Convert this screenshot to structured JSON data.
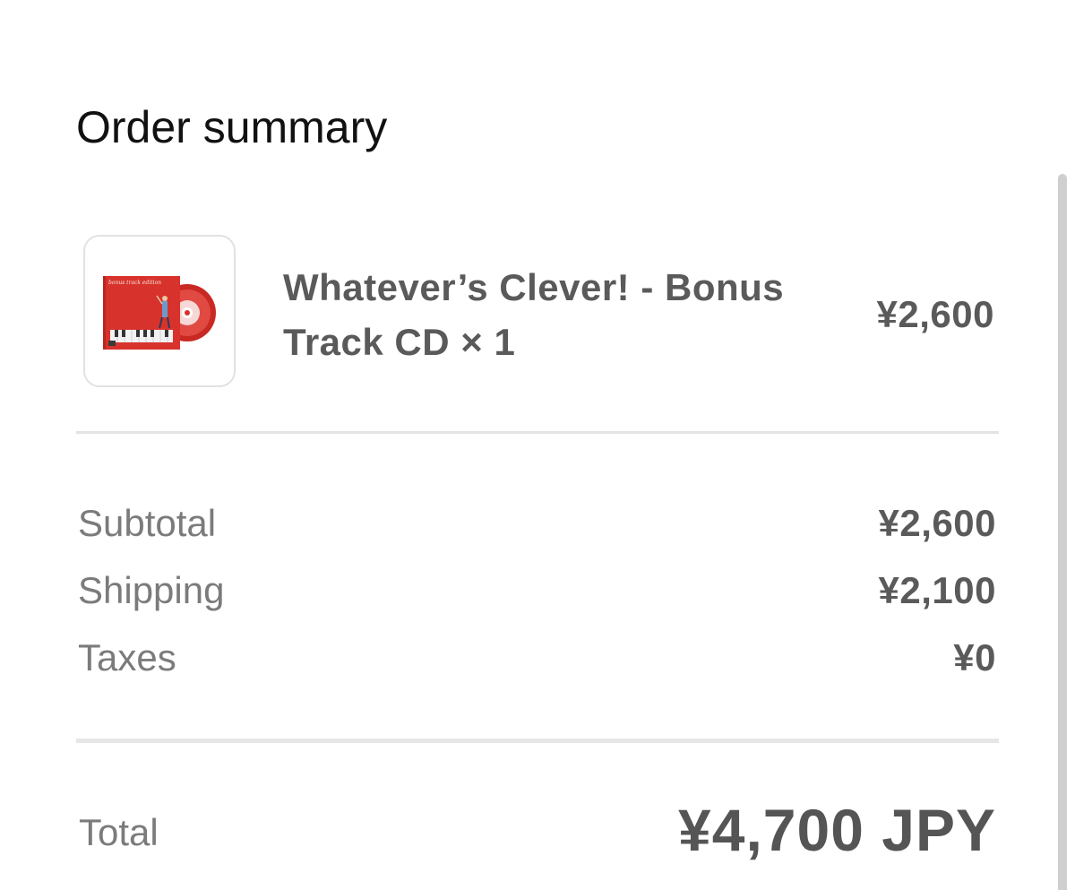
{
  "header": {
    "title": "Order summary"
  },
  "line_items": [
    {
      "name": "Whatever’s Clever! - Bonus Track CD × 1",
      "price": "¥2,600",
      "cover_text": "bonus track edition"
    }
  ],
  "summary": {
    "subtotal_label": "Subtotal",
    "subtotal_value": "¥2,600",
    "shipping_label": "Shipping",
    "shipping_value": "¥2,100",
    "taxes_label": "Taxes",
    "taxes_value": "¥0"
  },
  "total": {
    "label": "Total",
    "value": "¥4,700 JPY"
  },
  "colors": {
    "album_red": "#d8322c",
    "text_dark": "#111111",
    "text_value": "#5a5a5a",
    "text_label": "#7b7b7b"
  }
}
